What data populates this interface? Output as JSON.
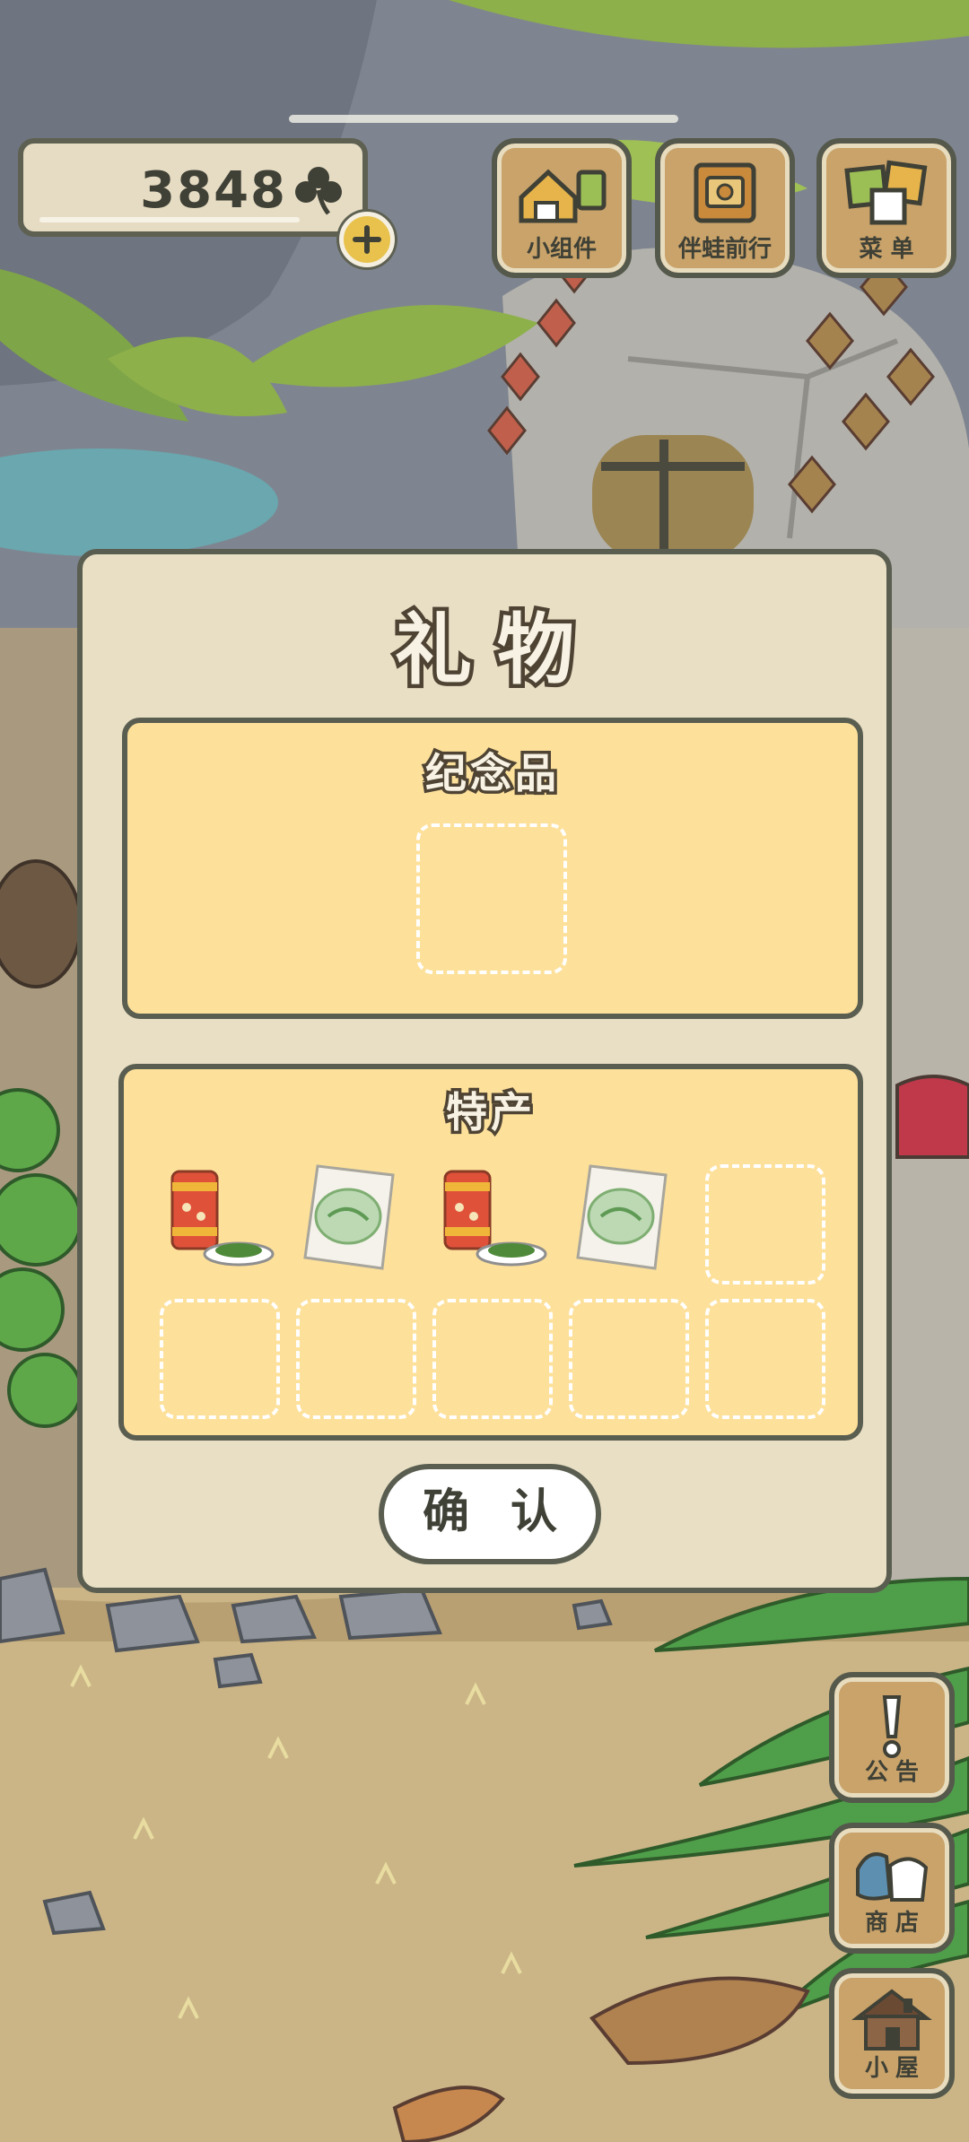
{
  "hud": {
    "clover_count": "3848",
    "buttons": {
      "widgets_label": "小组件",
      "travel_label": "伴蛙前行",
      "menu_label": "菜 单"
    }
  },
  "gift_dialog": {
    "title": "礼物",
    "souvenir_section": {
      "title": "纪念品",
      "slots_filled": 0,
      "slots_total": 1
    },
    "specialty_section": {
      "title": "特产",
      "items": [
        {
          "icon": "canned-tea-with-snack-icon"
        },
        {
          "icon": "seaweed-bag-icon"
        },
        {
          "icon": "canned-tea-with-snack-icon"
        },
        {
          "icon": "seaweed-bag-icon"
        }
      ],
      "slots_total": 10
    },
    "confirm_label": "确 认"
  },
  "side_menu": {
    "notice_label": "公告",
    "shop_label": "商店",
    "house_label": "小屋"
  },
  "colors": {
    "dialog_bg": "#e9dfc4",
    "section_bg": "#fde09a",
    "outline": "#5a5e50",
    "wood": "#c9a36a"
  }
}
